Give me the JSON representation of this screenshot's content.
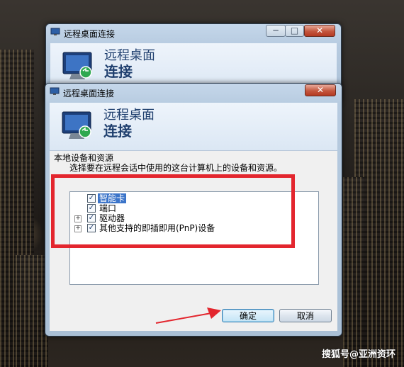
{
  "back_window": {
    "title": "远程桌面连接",
    "banner_line1": "远程桌面",
    "banner_line2": "连接",
    "minimize_glyph": "─",
    "maximize_glyph": "□",
    "close_glyph": "✕"
  },
  "dialog": {
    "title": "远程桌面连接",
    "close_glyph": "✕",
    "banner_line1": "远程桌面",
    "banner_line2": "连接",
    "group_label": "本地设备和资源",
    "description": "选择要在远程会话中使用的这台计算机上的设备和资源。",
    "tree": [
      {
        "label": "智能卡",
        "checked": true,
        "expandable": false,
        "selected": true
      },
      {
        "label": "端口",
        "checked": true,
        "expandable": false,
        "selected": false
      },
      {
        "label": "驱动器",
        "checked": true,
        "expandable": true,
        "selected": false
      },
      {
        "label": "其他支持的即插即用(PnP)设备",
        "checked": true,
        "expandable": true,
        "selected": false
      }
    ],
    "ok_label": "确定",
    "cancel_label": "取消"
  },
  "colors": {
    "highlight_box": "#e3262e",
    "arrow": "#e3262e",
    "selection": "#3b74c9"
  },
  "watermark": "搜狐号@亚洲资环"
}
